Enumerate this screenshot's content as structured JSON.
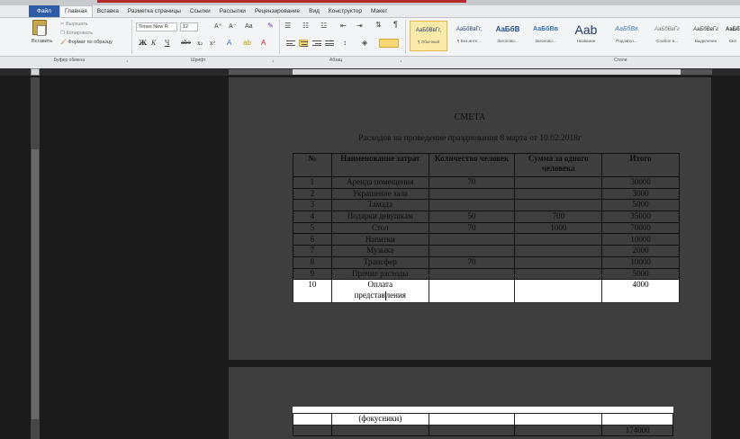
{
  "ribbon": {
    "tabs": [
      {
        "label": "Файл"
      },
      {
        "label": "Главная"
      },
      {
        "label": "Вставка"
      },
      {
        "label": "Разметка страницы"
      },
      {
        "label": "Ссылки"
      },
      {
        "label": "Рассылки"
      },
      {
        "label": "Рецензирование"
      },
      {
        "label": "Вид"
      },
      {
        "label": "Конструктор"
      },
      {
        "label": "Макет"
      }
    ],
    "clipboard": {
      "paste": "Вставить",
      "cut": "Вырезать",
      "copy": "Копировать",
      "format_painter": "Формат по образцу",
      "group": "Буфер обмена"
    },
    "font": {
      "name": "Times New R",
      "size": "12",
      "grow": "A⁺",
      "shrink": "A⁻",
      "case": "Aa",
      "bold": "Ж",
      "italic": "К",
      "underline": "Ч",
      "strike": "abe",
      "sub": "x₂",
      "sup": "x²",
      "group": "Шрифт"
    },
    "paragraph": {
      "group": "Абзац"
    },
    "styles": {
      "group": "Стили",
      "items": [
        {
          "sample": "АаБбВвГг,",
          "name": "¶ Обычный"
        },
        {
          "sample": "АаБбВвГг,",
          "name": "¶ Без инте..."
        },
        {
          "sample": "АаБбВ",
          "name": "Заголово..."
        },
        {
          "sample": "АаБбВв",
          "name": "Заголово..."
        },
        {
          "sample": "Aab",
          "name": "Название"
        },
        {
          "sample": "АаБбВв",
          "name": "Подзагол..."
        },
        {
          "sample": "АаБбВвГг",
          "name": "Слабое в..."
        },
        {
          "sample": "АаБбВвГг",
          "name": "Выделение"
        },
        {
          "sample": "АаБбВв",
          "name": "Сил"
        }
      ]
    }
  },
  "document": {
    "title": "СМЕТА",
    "subtitle": "Расходов на проведение празднования 8 марта от 10.02.2018г",
    "table": {
      "headers": [
        "№",
        "Наименование затрат",
        "Количество человек",
        "Сумма за одного человека",
        "Итого"
      ],
      "rows": [
        [
          "1",
          "Аренда помещения",
          "70",
          "",
          "30000"
        ],
        [
          "2",
          "Украшение зала",
          "",
          "",
          "3000"
        ],
        [
          "3",
          "Тамада",
          "",
          "",
          "5000"
        ],
        [
          "4",
          "Подарки девушкам",
          "50",
          "700",
          "35000"
        ],
        [
          "5",
          "Стол",
          "70",
          "1000",
          "70000"
        ],
        [
          "6",
          "Напитки",
          "",
          "",
          "10000"
        ],
        [
          "7",
          "Музыка",
          "",
          "",
          "2000"
        ],
        [
          "8",
          "Трансфер",
          "70",
          "",
          "10000"
        ],
        [
          "9",
          "Прочие расходы",
          "",
          "",
          "5000"
        ]
      ],
      "selected_row": {
        "num": "10",
        "name_line1": "Оплата",
        "name_line2a": "представ",
        "name_line2b": "ления",
        "total": "4000"
      },
      "continued_row": {
        "name": "(фокусники)"
      },
      "total_row": {
        "total": "174000"
      }
    }
  }
}
